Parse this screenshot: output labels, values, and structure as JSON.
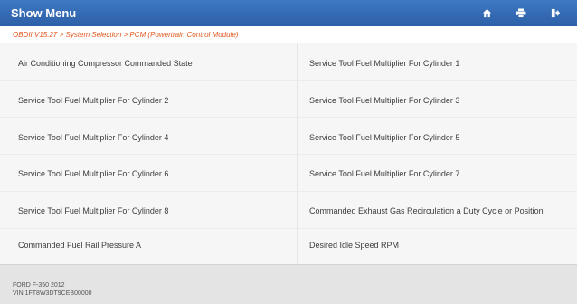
{
  "header": {
    "title": "Show Menu",
    "icons": [
      "home-icon",
      "print-icon",
      "exit-icon"
    ]
  },
  "breadcrumb": "OBDII V15.27 > System Selection > PCM (Powertrain Control Module)",
  "items": [
    "Air Conditioning Compressor Commanded State",
    "Service Tool Fuel Multiplier For Cylinder 1",
    "Service Tool Fuel Multiplier For Cylinder 2",
    "Service Tool Fuel Multiplier For Cylinder 3",
    "Service Tool Fuel Multiplier For Cylinder 4",
    "Service Tool Fuel Multiplier For Cylinder 5",
    "Service Tool Fuel Multiplier For Cylinder 6",
    "Service Tool Fuel Multiplier For Cylinder 7",
    "Service Tool Fuel Multiplier For Cylinder 8",
    "Commanded Exhaust Gas Recirculation a Duty Cycle or Position",
    "Commanded Fuel Rail Pressure A",
    "Desired Idle Speed RPM"
  ],
  "footer": {
    "vehicle": "FORD F-350 2012",
    "vin": "VIN 1FT8W3DT9CEB00000"
  },
  "colors": {
    "header": "#3366b3",
    "breadcrumb": "#e0581f",
    "list_background": "#f6f6f6",
    "footer_background": "#e4e4e4"
  }
}
